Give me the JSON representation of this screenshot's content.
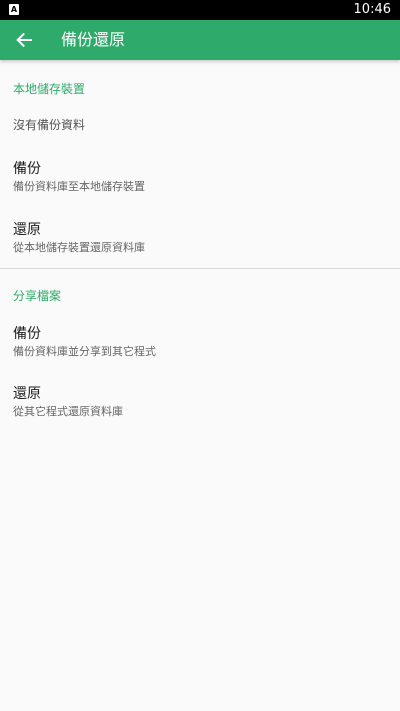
{
  "status_bar": {
    "notification_icon": "A",
    "time": "10:46"
  },
  "toolbar": {
    "back_icon": "arrow-left-icon",
    "title": "備份還原"
  },
  "sections": [
    {
      "header": "本地儲存裝置",
      "info": "沒有備份資料",
      "items": [
        {
          "title": "備份",
          "summary": "備份資料庫至本地儲存裝置"
        },
        {
          "title": "還原",
          "summary": "從本地儲存裝置還原資料庫"
        }
      ]
    },
    {
      "header": "分享檔案",
      "items": [
        {
          "title": "備份",
          "summary": "備份資料庫並分享到其它程式"
        },
        {
          "title": "還原",
          "summary": "從其它程式還原資料庫"
        }
      ]
    }
  ],
  "colors": {
    "accent": "#2eaa6b",
    "status_bar": "#000000",
    "background": "#fafafa"
  }
}
